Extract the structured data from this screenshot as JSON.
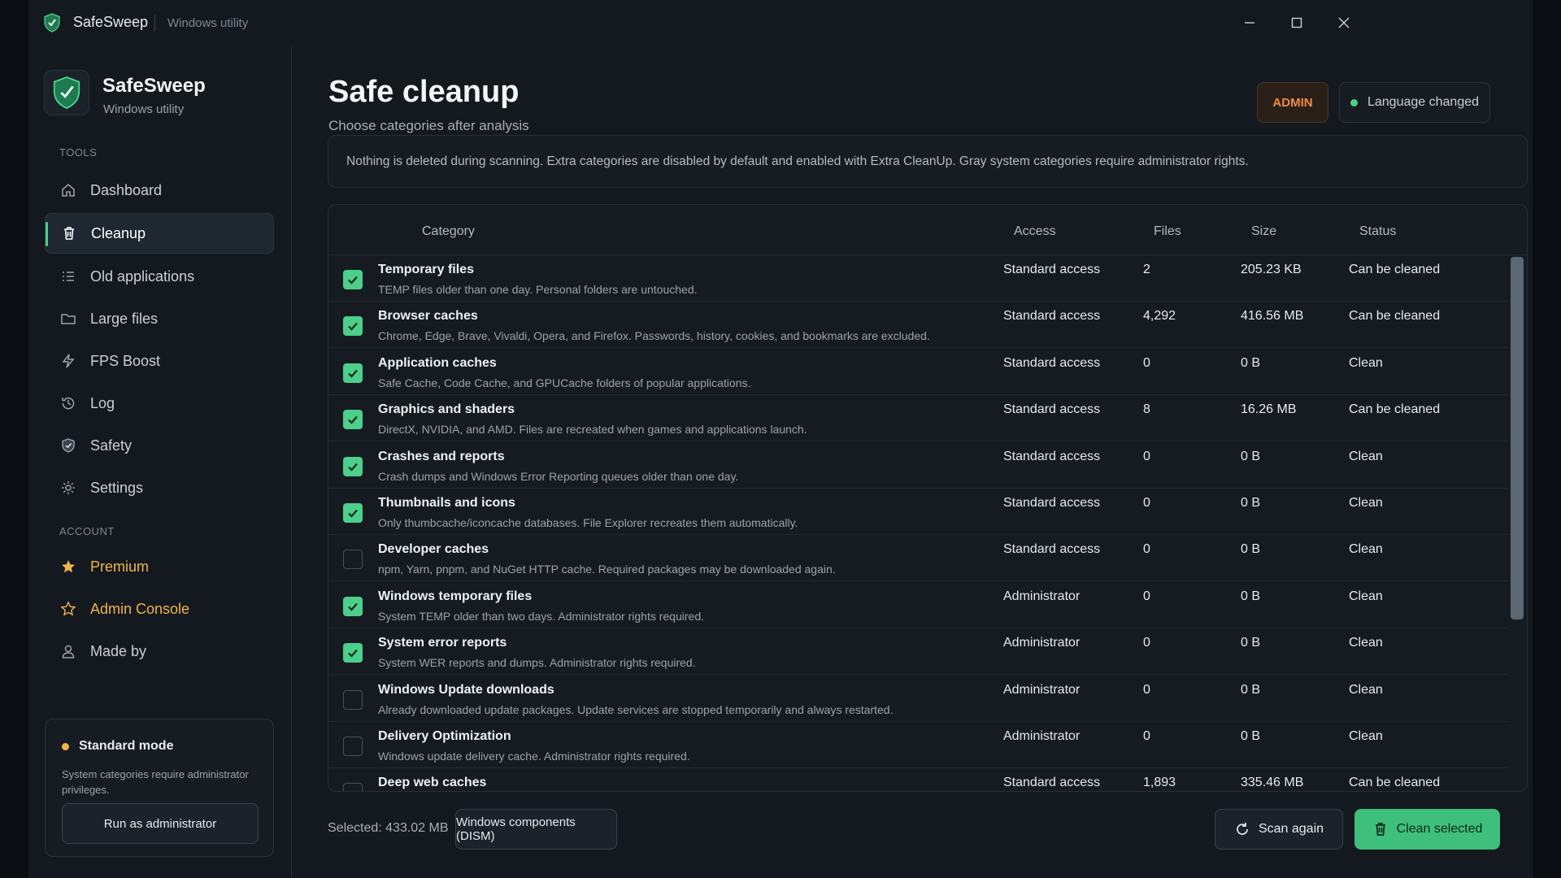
{
  "titlebar": {
    "app_name": "SafeSweep",
    "subtitle": "Windows utility"
  },
  "brand": {
    "name": "SafeSweep",
    "subtitle": "Windows utility"
  },
  "sidebar": {
    "tools_label": "TOOLS",
    "tools": [
      {
        "label": "Dashboard",
        "icon": "home-icon"
      },
      {
        "label": "Cleanup",
        "icon": "trash-icon",
        "active": true
      },
      {
        "label": "Old applications",
        "icon": "list-icon"
      },
      {
        "label": "Large files",
        "icon": "folder-icon"
      },
      {
        "label": "FPS Boost",
        "icon": "bolt-icon"
      },
      {
        "label": "Log",
        "icon": "history-icon"
      },
      {
        "label": "Safety",
        "icon": "shield-icon"
      },
      {
        "label": "Settings",
        "icon": "gear-icon"
      }
    ],
    "account_label": "ACCOUNT",
    "account": [
      {
        "label": "Premium",
        "icon": "star-filled-icon"
      },
      {
        "label": "Admin Console",
        "icon": "star-outline-icon"
      },
      {
        "label": "Made by",
        "icon": "user-icon"
      }
    ],
    "mode": {
      "title": "Standard mode",
      "description": "System categories require administrator privileges.",
      "button": "Run as administrator"
    }
  },
  "header": {
    "title": "Safe cleanup",
    "subtitle": "Choose categories after analysis",
    "admin_badge": "ADMIN",
    "status_badge": "Language changed"
  },
  "info": "Nothing is deleted during scanning. Extra categories are disabled by default and enabled with Extra CleanUp. Gray system categories require administrator rights.",
  "table": {
    "columns": [
      "Category",
      "Access",
      "Files",
      "Size",
      "Status"
    ],
    "rows": [
      {
        "checked": true,
        "title": "Temporary files",
        "desc": "TEMP files older than one day. Personal folders are untouched.",
        "access": "Standard access",
        "files": "2",
        "size": "205.23 KB",
        "status": "Can be cleaned"
      },
      {
        "checked": true,
        "title": "Browser caches",
        "desc": "Chrome, Edge, Brave, Vivaldi, Opera, and Firefox. Passwords, history, cookies, and bookmarks are excluded.",
        "access": "Standard access",
        "files": "4,292",
        "size": "416.56 MB",
        "status": "Can be cleaned"
      },
      {
        "checked": true,
        "title": "Application caches",
        "desc": "Safe Cache, Code Cache, and GPUCache folders of popular applications.",
        "access": "Standard access",
        "files": "0",
        "size": "0 B",
        "status": "Clean"
      },
      {
        "checked": true,
        "title": "Graphics and shaders",
        "desc": "DirectX, NVIDIA, and AMD. Files are recreated when games and applications launch.",
        "access": "Standard access",
        "files": "8",
        "size": "16.26 MB",
        "status": "Can be cleaned"
      },
      {
        "checked": true,
        "title": "Crashes and reports",
        "desc": "Crash dumps and Windows Error Reporting queues older than one day.",
        "access": "Standard access",
        "files": "0",
        "size": "0 B",
        "status": "Clean"
      },
      {
        "checked": true,
        "title": "Thumbnails and icons",
        "desc": "Only thumbcache/iconcache databases. File Explorer recreates them automatically.",
        "access": "Standard access",
        "files": "0",
        "size": "0 B",
        "status": "Clean"
      },
      {
        "checked": false,
        "title": "Developer caches",
        "desc": "npm, Yarn, pnpm, and NuGet HTTP cache. Required packages may be downloaded again.",
        "access": "Standard access",
        "files": "0",
        "size": "0 B",
        "status": "Clean"
      },
      {
        "checked": true,
        "title": "Windows temporary files",
        "desc": "System TEMP older than two days. Administrator rights required.",
        "access": "Administrator",
        "files": "0",
        "size": "0 B",
        "status": "Clean"
      },
      {
        "checked": true,
        "title": "System error reports",
        "desc": "System WER reports and dumps. Administrator rights required.",
        "access": "Administrator",
        "files": "0",
        "size": "0 B",
        "status": "Clean"
      },
      {
        "checked": false,
        "title": "Windows Update downloads",
        "desc": "Already downloaded update packages. Update services are stopped temporarily and always restarted.",
        "access": "Administrator",
        "files": "0",
        "size": "0 B",
        "status": "Clean"
      },
      {
        "checked": false,
        "title": "Delivery Optimization",
        "desc": "Windows update delivery cache. Administrator rights required.",
        "access": "Administrator",
        "files": "0",
        "size": "0 B",
        "status": "Clean"
      },
      {
        "checked": false,
        "title": "Deep web caches",
        "desc": "",
        "access": "Standard access",
        "files": "1,893",
        "size": "335.46 MB",
        "status": "Can be cleaned"
      }
    ]
  },
  "footer": {
    "selected": "Selected: 433.02 MB",
    "dism_button": "Windows components (DISM)",
    "scan_button": "Scan again",
    "clean_button": "Clean selected"
  },
  "colors": {
    "accent": "#4ccf8a",
    "admin": "#f08a4b",
    "premium": "#f0b44c"
  }
}
